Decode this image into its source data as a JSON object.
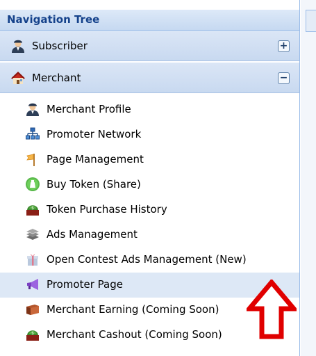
{
  "nav": {
    "title": "Navigation Tree"
  },
  "sections": {
    "subscriber": {
      "label": "Subscriber",
      "icon": "user-icon",
      "toggle": "+"
    },
    "merchant": {
      "label": "Merchant",
      "icon": "house-icon",
      "toggle": "−"
    }
  },
  "merchant_items": [
    {
      "label": "Merchant Profile",
      "icon": "user-icon"
    },
    {
      "label": "Promoter Network",
      "icon": "network-icon"
    },
    {
      "label": "Page Management",
      "icon": "flag-icon"
    },
    {
      "label": "Buy Token (Share)",
      "icon": "token-icon"
    },
    {
      "label": "Token Purchase History",
      "icon": "money-icon"
    },
    {
      "label": "Ads Management",
      "icon": "stack-icon"
    },
    {
      "label": "Open Contest Ads Management (New)",
      "icon": "gift-icon"
    },
    {
      "label": "Promoter Page",
      "icon": "megaphone-icon"
    },
    {
      "label": "Merchant Earning (Coming Soon)",
      "icon": "box-icon"
    },
    {
      "label": "Merchant Cashout (Coming Soon)",
      "icon": "money-icon"
    }
  ],
  "colors": {
    "header_text": "#15428b",
    "selected_row": "#dde8f6",
    "annotation_arrow": "#e00000"
  }
}
